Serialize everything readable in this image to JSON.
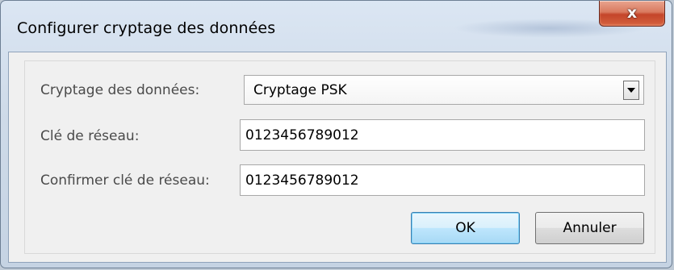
{
  "window": {
    "title": "Configurer cryptage des données",
    "close_glyph": "x"
  },
  "form": {
    "encryption_label": "Cryptage des données:",
    "encryption_value": "Cryptage PSK",
    "network_key_label": "Clé de réseau:",
    "network_key_value": "0123456789012",
    "confirm_key_label": "Confirmer clé de réseau:",
    "confirm_key_value": "0123456789012"
  },
  "buttons": {
    "ok_label": "OK",
    "cancel_label": "Annuler"
  },
  "icons": {
    "close": "close-icon",
    "dropdown": "chevron-down-icon"
  }
}
